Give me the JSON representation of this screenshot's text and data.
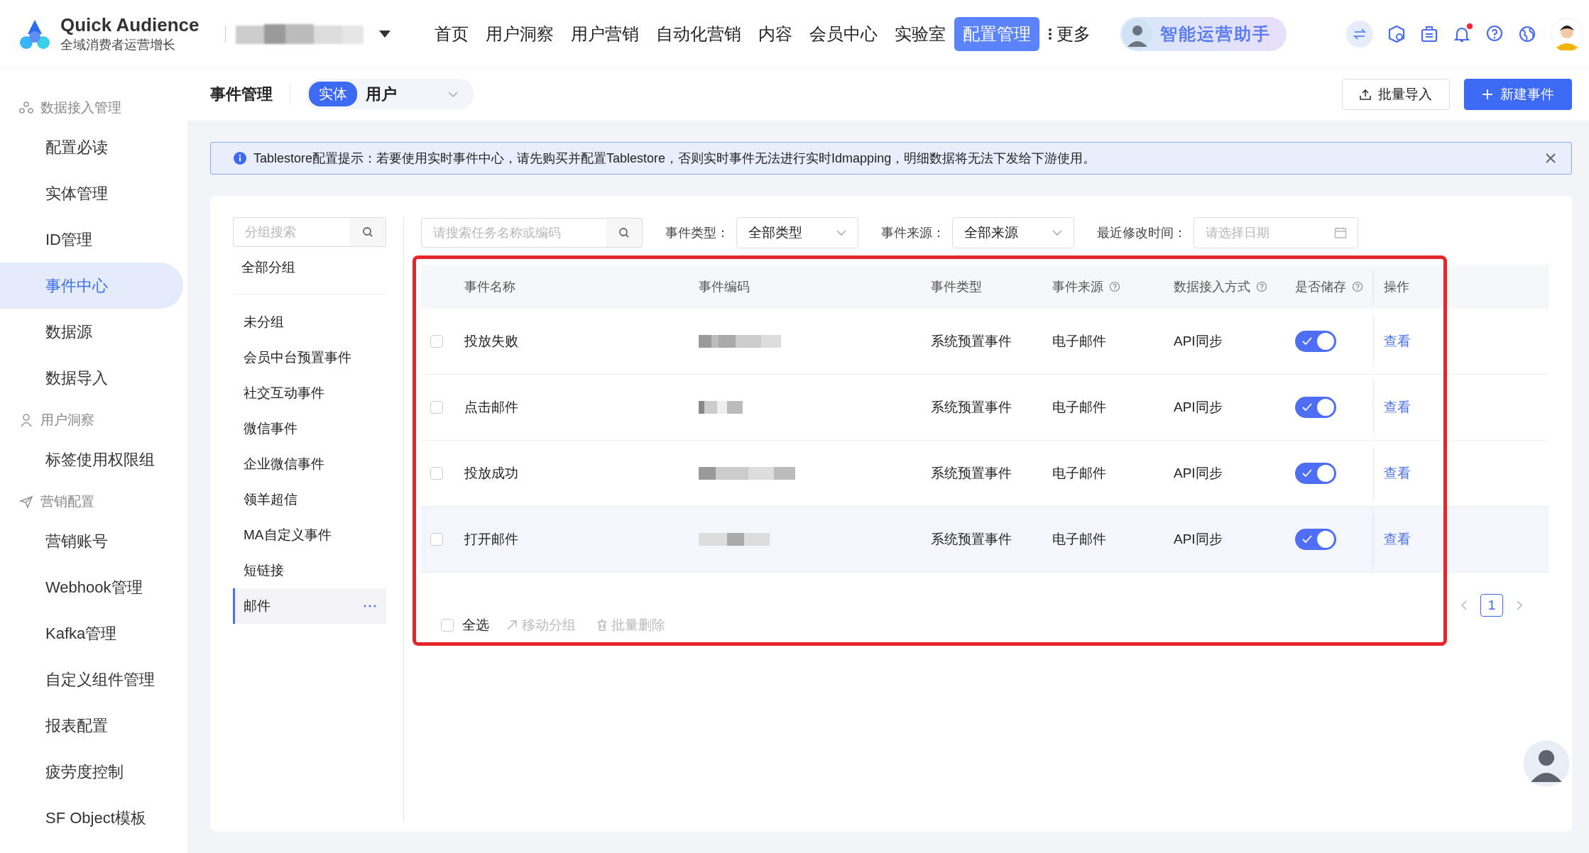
{
  "header": {
    "logo_title": "Quick Audience",
    "logo_subtitle": "全域消费者运营增长",
    "nav": [
      {
        "label": "首页",
        "selected": false
      },
      {
        "label": "用户洞察",
        "selected": false
      },
      {
        "label": "用户营销",
        "selected": false
      },
      {
        "label": "自动化营销",
        "selected": false
      },
      {
        "label": "内容",
        "selected": false
      },
      {
        "label": "会员中心",
        "selected": false
      },
      {
        "label": "实验室",
        "selected": false
      },
      {
        "label": "配置管理",
        "selected": true
      }
    ],
    "more": "更多",
    "assistant": "智能运营助手",
    "notifications_unread": true
  },
  "sidebar": {
    "sections": [
      {
        "title": "数据接入管理",
        "items": [
          {
            "label": "配置必读",
            "selected": false
          },
          {
            "label": "实体管理",
            "selected": false
          },
          {
            "label": "ID管理",
            "selected": false
          },
          {
            "label": "事件中心",
            "selected": true
          },
          {
            "label": "数据源",
            "selected": false
          },
          {
            "label": "数据导入",
            "selected": false
          }
        ]
      },
      {
        "title": "用户洞察",
        "items": [
          {
            "label": "标签使用权限组",
            "selected": false
          }
        ]
      },
      {
        "title": "营销配置",
        "items": [
          {
            "label": "营销账号",
            "selected": false
          },
          {
            "label": "Webhook管理",
            "selected": false
          },
          {
            "label": "Kafka管理",
            "selected": false
          },
          {
            "label": "自定义组件管理",
            "selected": false
          },
          {
            "label": "报表配置",
            "selected": false
          },
          {
            "label": "疲劳度控制",
            "selected": false
          },
          {
            "label": "SF Object模板",
            "selected": false
          }
        ]
      }
    ]
  },
  "page": {
    "title": "事件管理",
    "entity_tag": "实体",
    "entity": "用户",
    "buttons": [
      {
        "label": "批量导入",
        "kind": "secondary"
      },
      {
        "label": "新建事件",
        "kind": "primary"
      }
    ]
  },
  "alert": {
    "text": "Tablestore配置提示：若要使用实时事件中心，请先购买并配置Tablestore，否则实时事件无法进行实时Idmapping，明细数据将无法下发给下游使用。"
  },
  "groups": {
    "search_placeholder": "分组搜索",
    "all": "全部分组",
    "items": [
      {
        "label": "未分组",
        "selected": false
      },
      {
        "label": "会员中台预置事件",
        "selected": false
      },
      {
        "label": "社交互动事件",
        "selected": false
      },
      {
        "label": "微信事件",
        "selected": false
      },
      {
        "label": "企业微信事件",
        "selected": false
      },
      {
        "label": "领羊超信",
        "selected": false
      },
      {
        "label": "MA自定义事件",
        "selected": false
      },
      {
        "label": "短链接",
        "selected": false
      },
      {
        "label": "邮件",
        "selected": true
      }
    ]
  },
  "filters": {
    "search_placeholder": "请搜索任务名称或编码",
    "fields": [
      {
        "label": "事件类型：",
        "kind": "select",
        "value": "全部类型"
      },
      {
        "label": "事件来源：",
        "kind": "select",
        "value": "全部来源"
      },
      {
        "label": "最近修改时间：",
        "kind": "date",
        "placeholder": "请选择日期"
      }
    ]
  },
  "table": {
    "columns": [
      {
        "label": "事件名称",
        "help": false
      },
      {
        "label": "事件编码",
        "help": false
      },
      {
        "label": "事件类型",
        "help": false
      },
      {
        "label": "事件来源",
        "help": true
      },
      {
        "label": "数据接入方式",
        "help": true
      },
      {
        "label": "是否储存",
        "help": true
      },
      {
        "label": "操作",
        "help": false
      }
    ],
    "rows": [
      {
        "checked": false,
        "highlighted": false,
        "name": "投放失败",
        "type": "系统预置事件",
        "source": "电子邮件",
        "method": "API同步",
        "stored": true,
        "action": "查看"
      },
      {
        "checked": false,
        "highlighted": false,
        "name": "点击邮件",
        "type": "系统预置事件",
        "source": "电子邮件",
        "method": "API同步",
        "stored": true,
        "action": "查看"
      },
      {
        "checked": false,
        "highlighted": false,
        "name": "投放成功",
        "type": "系统预置事件",
        "source": "电子邮件",
        "method": "API同步",
        "stored": true,
        "action": "查看"
      },
      {
        "checked": false,
        "highlighted": true,
        "name": "打开邮件",
        "type": "系统预置事件",
        "source": "电子邮件",
        "method": "API同步",
        "stored": true,
        "action": "查看"
      }
    ]
  },
  "footer": {
    "select_all": {
      "label": "全选",
      "checked": false
    },
    "actions": [
      {
        "label": "移动分组",
        "disabled": true
      },
      {
        "label": "批量删除",
        "disabled": true
      }
    ]
  },
  "pagination": {
    "pages": [
      {
        "label": "1",
        "selected": true
      }
    ]
  }
}
